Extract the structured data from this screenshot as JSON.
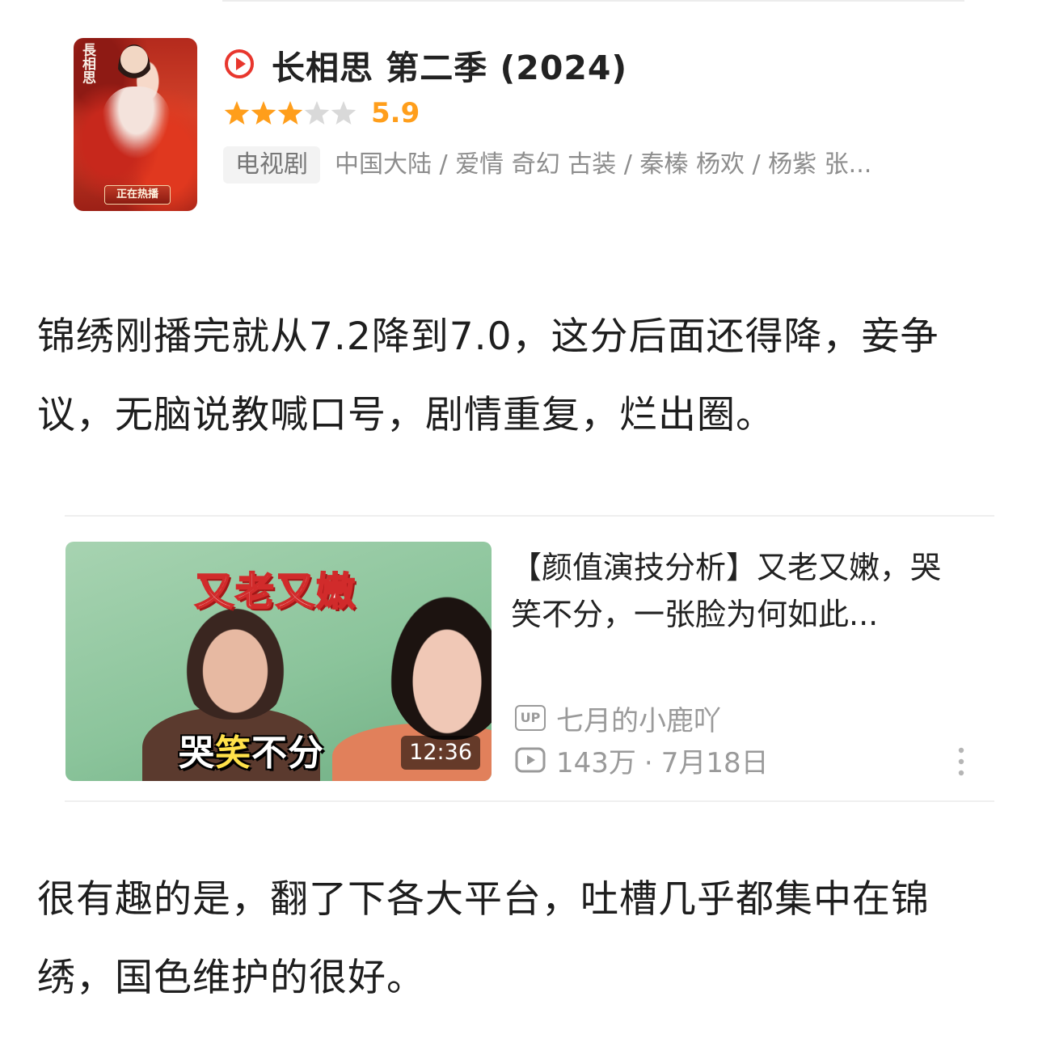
{
  "show": {
    "title": "长相思 第二季 (2024)",
    "rating": "5.9",
    "stars_filled": 3,
    "stars_total": 5,
    "type_tag": "电视剧",
    "meta": "中国大陆 / 爱情 奇幻 古装 / 秦榛 杨欢 / 杨紫 张...",
    "poster_calligraphy": "長相思",
    "poster_badge": "正在热播",
    "accent_color": "#e8362d",
    "star_color": "#ff9e1b"
  },
  "paragraph_1": "锦绣刚播完就从7.2降到7.0，这分后面还得降，妾争议，无脑说教喊口号，剧情重复，烂出圈。",
  "video": {
    "thumb_caption_top": "又老又嫩",
    "thumb_caption_bottom_white_1": "哭",
    "thumb_caption_bottom_yellow": "笑",
    "thumb_caption_bottom_white_2": "不分",
    "duration": "12:36",
    "title": "【颜值演技分析】又老又嫩，哭笑不分，一张脸为何如此...",
    "up_label": "UP",
    "uploader": "七月的小鹿吖",
    "views": "143万",
    "separator": "·",
    "date": "7月18日"
  },
  "paragraph_2": "很有趣的是，翻了下各大平台，吐槽几乎都集中在锦绣，国色维护的很好。"
}
